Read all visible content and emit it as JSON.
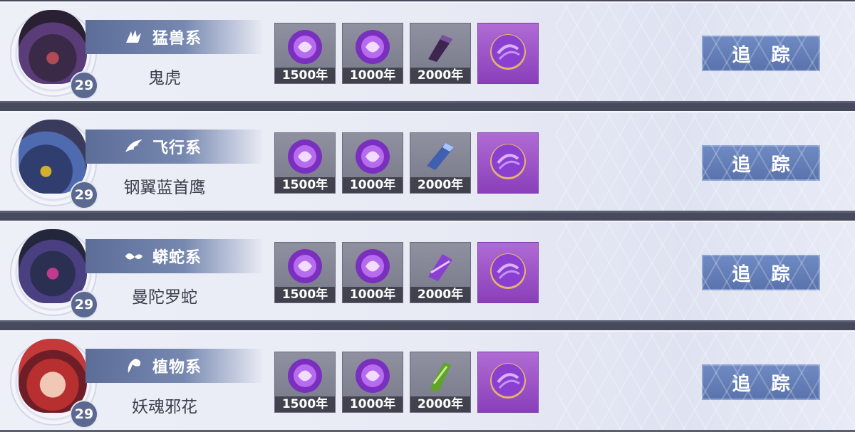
{
  "track_label": "追 踪",
  "rows": [
    {
      "type": "猛兽系",
      "type_icon": "claw-icon",
      "name": "鬼虎",
      "level": "29",
      "avatar": "ghost-tiger-portrait",
      "items": [
        {
          "icon": "spirit-orb-icon",
          "age": "1500年"
        },
        {
          "icon": "spirit-orb-icon",
          "age": "1000年"
        },
        {
          "icon": "claw-bone-icon",
          "age": "2000年"
        },
        {
          "icon": "purple-sphere-icon",
          "age": ""
        }
      ]
    },
    {
      "type": "飞行系",
      "type_icon": "wing-icon",
      "name": "钢翼蓝首鹰",
      "level": "29",
      "avatar": "steel-wing-eagle-portrait",
      "items": [
        {
          "icon": "spirit-orb-icon",
          "age": "1500年"
        },
        {
          "icon": "spirit-orb-icon",
          "age": "1000年"
        },
        {
          "icon": "feather-bone-icon",
          "age": "2000年"
        },
        {
          "icon": "purple-sphere-icon",
          "age": ""
        }
      ]
    },
    {
      "type": "蟒蛇系",
      "type_icon": "serpent-icon",
      "name": "曼陀罗蛇",
      "level": "29",
      "avatar": "mandala-snake-portrait",
      "items": [
        {
          "icon": "spirit-orb-icon",
          "age": "1500年"
        },
        {
          "icon": "spirit-orb-icon",
          "age": "1000年"
        },
        {
          "icon": "snake-bone-icon",
          "age": "2000年"
        },
        {
          "icon": "purple-sphere-icon",
          "age": ""
        }
      ]
    },
    {
      "type": "植物系",
      "type_icon": "leaf-icon",
      "name": "妖魂邪花",
      "level": "29",
      "avatar": "demon-flower-portrait",
      "items": [
        {
          "icon": "spirit-orb-icon",
          "age": "1500年"
        },
        {
          "icon": "spirit-orb-icon",
          "age": "1000年"
        },
        {
          "icon": "vine-bone-icon",
          "age": "2000年"
        },
        {
          "icon": "purple-sphere-icon",
          "age": ""
        }
      ]
    }
  ],
  "colors": {
    "button": "#5a73ad",
    "banner": "#6d7fa8",
    "item_slot": "#808292",
    "rare_slot": "#9a52c6"
  }
}
